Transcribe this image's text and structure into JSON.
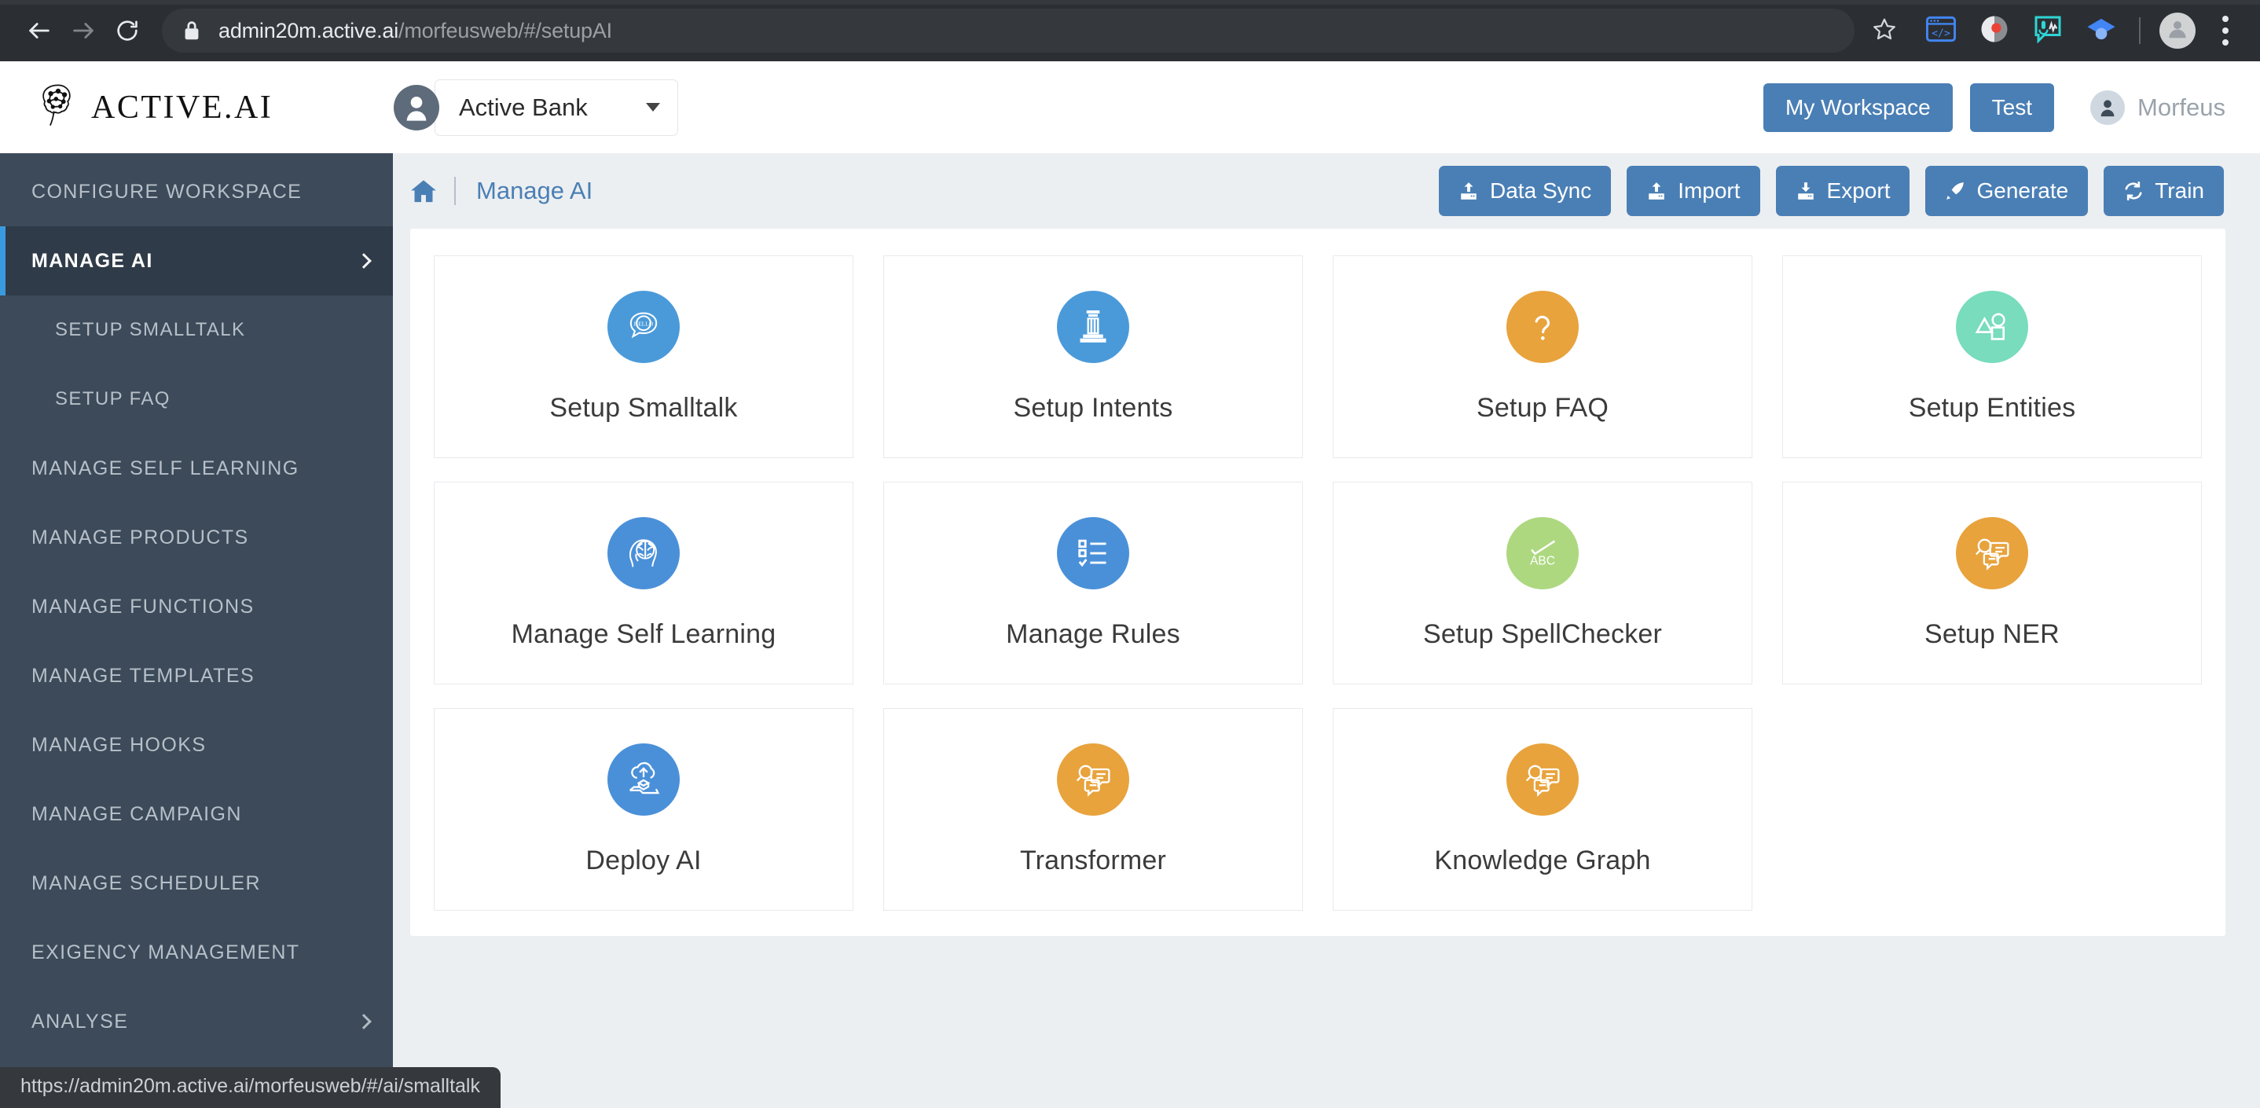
{
  "browser": {
    "back_icon": "back-arrow-icon",
    "forward_icon": "forward-arrow-icon",
    "reload_icon": "reload-icon",
    "lock_icon": "lock-icon",
    "url_domain": "admin20m.active.ai",
    "url_path": "/morfeusweb/#/setupAI",
    "star_icon": "bookmark-star-icon",
    "extensions": [
      {
        "name": "code-extension-icon"
      },
      {
        "name": "pocket-extension-icon"
      },
      {
        "name": "voice-recorder-extension-icon"
      },
      {
        "name": "google-scholar-extension-icon"
      }
    ],
    "profile_icon": "profile-avatar-icon",
    "menu_icon": "chrome-menu-kebab-icon",
    "status_url": "https://admin20m.active.ai/morfeusweb/#/ai/smalltalk"
  },
  "header": {
    "logo_icon": "brain-logo-icon",
    "logo_text": "ACTIVE.AI",
    "workspace_avatar_icon": "workspace-avatar-icon",
    "workspace_name": "Active Bank",
    "workspace_caret_icon": "chevron-down-icon",
    "my_workspace_label": "My Workspace",
    "test_label": "Test",
    "user_avatar_icon": "user-avatar-icon",
    "user_name": "Morfeus"
  },
  "sidebar": {
    "items": [
      {
        "label": "Configure Workspace",
        "active": false,
        "sub": false,
        "chevron": false
      },
      {
        "label": "Manage AI",
        "active": true,
        "sub": false,
        "chevron": true
      },
      {
        "label": "Setup Smalltalk",
        "active": false,
        "sub": true,
        "chevron": false
      },
      {
        "label": "Setup FAQ",
        "active": false,
        "sub": true,
        "chevron": false
      },
      {
        "label": "Manage Self Learning",
        "active": false,
        "sub": false,
        "chevron": false
      },
      {
        "label": "Manage Products",
        "active": false,
        "sub": false,
        "chevron": false
      },
      {
        "label": "Manage Functions",
        "active": false,
        "sub": false,
        "chevron": false
      },
      {
        "label": "Manage Templates",
        "active": false,
        "sub": false,
        "chevron": false
      },
      {
        "label": "Manage Hooks",
        "active": false,
        "sub": false,
        "chevron": false
      },
      {
        "label": "Manage Campaign",
        "active": false,
        "sub": false,
        "chevron": false
      },
      {
        "label": "Manage Scheduler",
        "active": false,
        "sub": false,
        "chevron": false
      },
      {
        "label": "Exigency Management",
        "active": false,
        "sub": false,
        "chevron": false
      },
      {
        "label": "Analyse",
        "active": false,
        "sub": false,
        "chevron": true
      }
    ]
  },
  "breadcrumb": {
    "home_icon": "home-icon",
    "current": "Manage AI"
  },
  "toolbar": {
    "buttons": [
      {
        "label": "Data Sync",
        "icon": "upload-icon"
      },
      {
        "label": "Import",
        "icon": "upload-icon"
      },
      {
        "label": "Export",
        "icon": "download-icon"
      },
      {
        "label": "Generate",
        "icon": "rocket-icon"
      },
      {
        "label": "Train",
        "icon": "refresh-icon"
      }
    ]
  },
  "cards": [
    {
      "label": "Setup Smalltalk",
      "icon": "hello-speech-bubble-icon",
      "color": "#4a9ada"
    },
    {
      "label": "Setup Intents",
      "icon": "bank-building-icon",
      "color": "#4a9ada"
    },
    {
      "label": "Setup FAQ",
      "icon": "question-mark-icon",
      "color": "#e8a33d"
    },
    {
      "label": "Setup Entities",
      "icon": "shapes-icon",
      "color": "#78dcbd"
    },
    {
      "label": "Manage Self Learning",
      "icon": "head-brain-icon",
      "color": "#4a90d9"
    },
    {
      "label": "Manage Rules",
      "icon": "checklist-icon",
      "color": "#4a90d9"
    },
    {
      "label": "Setup SpellChecker",
      "icon": "abc-check-icon",
      "color": "#add880"
    },
    {
      "label": "Setup NER",
      "icon": "magnifier-chat-icon",
      "color": "#e8a33d"
    },
    {
      "label": "Deploy AI",
      "icon": "cloud-upload-icon",
      "color": "#4a90d9"
    },
    {
      "label": "Transformer",
      "icon": "magnifier-chat-icon",
      "color": "#e8a33d"
    },
    {
      "label": "Knowledge Graph",
      "icon": "magnifier-chat-icon",
      "color": "#e8a33d"
    }
  ],
  "colors": {
    "accent_blue": "#4a7fb5",
    "sidebar_bg": "#3c4a59",
    "sidebar_active_bg": "#2f3b48",
    "sidebar_active_bar": "#3a9ae0",
    "content_bg": "#eceff1"
  }
}
